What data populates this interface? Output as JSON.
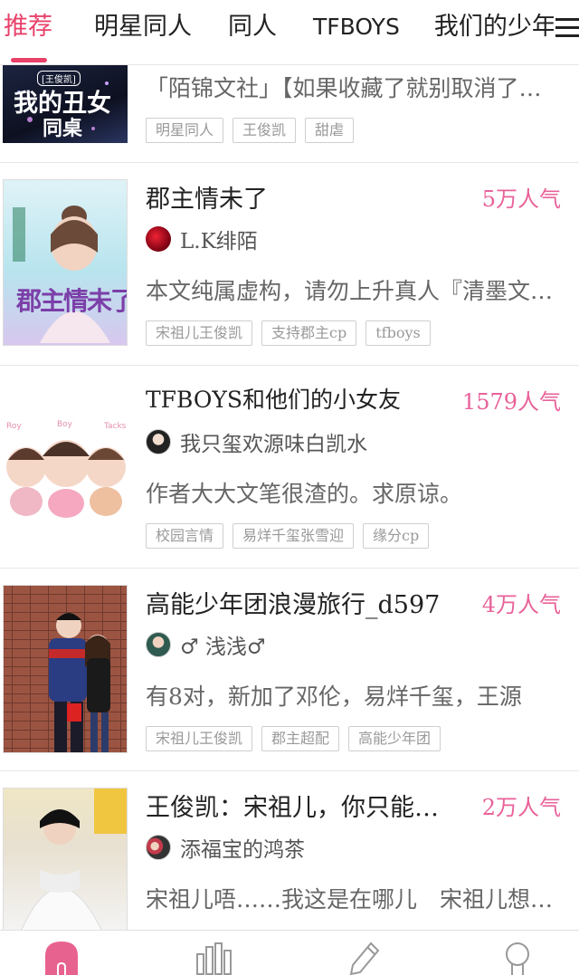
{
  "tabs": [
    {
      "label": "推荐",
      "active": true
    },
    {
      "label": "明星同人"
    },
    {
      "label": "同人"
    },
    {
      "label": "TFBOYS"
    },
    {
      "label": "我们的少年"
    }
  ],
  "items": [
    {
      "cover_text": [
        "[王俊凯]",
        "我的丑女",
        "同桌"
      ],
      "title": "",
      "desc": "「陌锦文社」【如果收藏了就别取消了…",
      "tags": [
        "明星同人",
        "王俊凯",
        "甜虐"
      ]
    },
    {
      "title": "郡主情未了",
      "popularity": "5万人气",
      "author": "L.K绯陌",
      "desc": "本文纯属虚构，请勿上升真人『清墨文…",
      "tags": [
        "宋祖儿王俊凯",
        "支持郡主cp",
        "tfboys"
      ],
      "cover_text": "郡主情未了"
    },
    {
      "title": "TFBOYS和他们的小女友",
      "popularity": "1579人气",
      "author": "我只玺欢源味白凯水",
      "desc": "作者大大文笔很渣的。求原谅。",
      "tags": [
        "校园言情",
        "易烊千玺张雪迎",
        "缘分cp"
      ],
      "cover_text": [
        "Roy",
        "Boy",
        "Tacks"
      ]
    },
    {
      "title": "高能少年团浪漫旅行_d597",
      "popularity": "4万人气",
      "author": "♂ 浅浅♂",
      "desc": "有8对，新加了邓伦，易烊千玺，王源",
      "tags": [
        "宋祖儿王俊凯",
        "郡主超配",
        "高能少年团"
      ]
    },
    {
      "title": "王俊凯：宋祖儿，你只能…",
      "popularity": "2万人气",
      "author": "添福宝的鸿茶",
      "desc": "宋祖儿唔……我这是在哪儿　宋祖儿想…"
    }
  ],
  "nav": [
    "home-icon",
    "ranking-icon",
    "write-icon",
    "profile-icon"
  ],
  "colors": {
    "accent": "#e8416a",
    "popularity": "#e8629a"
  }
}
